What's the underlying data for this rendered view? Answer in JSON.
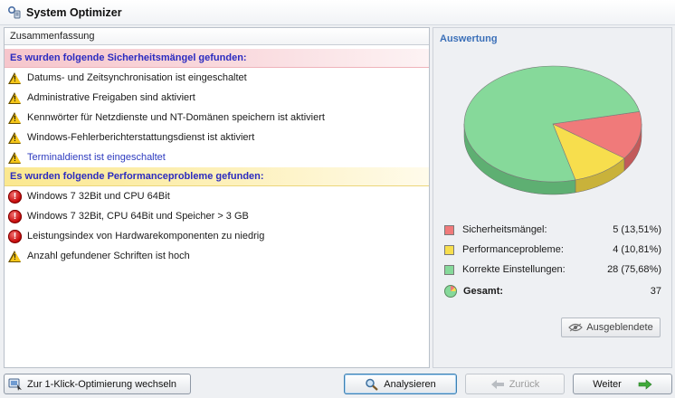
{
  "window": {
    "title": "System Optimizer",
    "icon": "system-optimizer-icon"
  },
  "summary": {
    "header": "Zusammenfassung",
    "groups": [
      {
        "title": "Es wurden folgende Sicherheitsmängel gefunden:",
        "type": "security",
        "items": [
          {
            "icon": "warning-icon",
            "text": "Datums- und Zeitsynchronisation ist eingeschaltet"
          },
          {
            "icon": "warning-icon",
            "text": "Administrative Freigaben sind aktiviert"
          },
          {
            "icon": "warning-icon",
            "text": "Kennwörter für Netzdienste und NT-Domänen speichern ist aktiviert"
          },
          {
            "icon": "warning-icon",
            "text": "Windows-Fehlerberichterstattungsdienst ist aktiviert"
          },
          {
            "icon": "warning-icon",
            "text": "Terminaldienst ist eingeschaltet",
            "link": true
          }
        ]
      },
      {
        "title": "Es wurden folgende Performanceprobleme gefunden:",
        "type": "performance",
        "items": [
          {
            "icon": "error-icon",
            "text": "Windows 7 32Bit und CPU 64Bit"
          },
          {
            "icon": "error-icon",
            "text": "Windows 7 32Bit, CPU 64Bit und Speicher > 3 GB"
          },
          {
            "icon": "error-icon",
            "text": "Leistungsindex von Hardwarekomponenten zu niedrig"
          },
          {
            "icon": "warning-icon",
            "text": "Anzahl gefundener Schriften ist hoch"
          }
        ]
      }
    ]
  },
  "evaluation": {
    "title": "Auswertung",
    "legend": [
      {
        "label": "Sicherheitsmängel:",
        "value": "5 (13,51%)",
        "count": 5,
        "color": "#f07a7a"
      },
      {
        "label": "Performanceprobleme:",
        "value": "4 (10,81%)",
        "count": 4,
        "color": "#f7de4d"
      },
      {
        "label": "Korrekte Einstellungen:",
        "value": "28 (75,68%)",
        "count": 28,
        "color": "#86d99a"
      }
    ],
    "total": {
      "label": "Gesamt:",
      "value": "37"
    },
    "hidden_button": "Ausgeblendete"
  },
  "footer": {
    "oneclick_button": "Zur 1-Klick-Optimierung  wechseln",
    "analyze_button": "Analysieren",
    "back_button": "Zurück",
    "next_button": "Weiter"
  }
}
